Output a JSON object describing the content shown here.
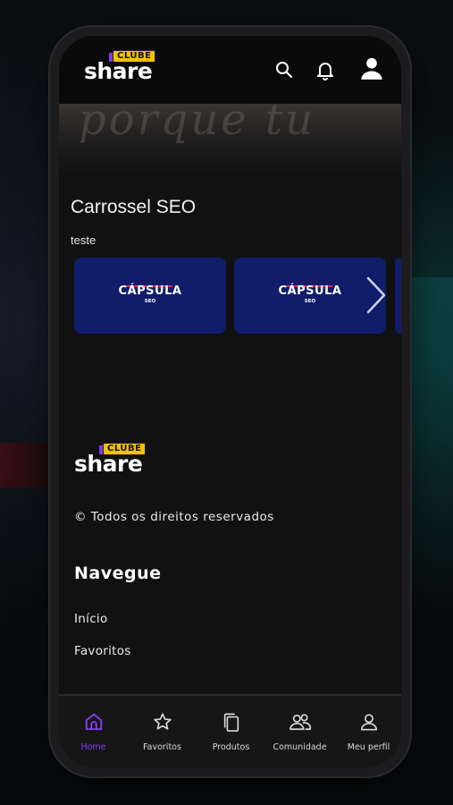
{
  "brand": {
    "badge": "CLUBE",
    "word": "share"
  },
  "header": {
    "icons": [
      "search-icon",
      "bell-icon",
      "user-icon"
    ]
  },
  "hero": {
    "text": "porque tu"
  },
  "section": {
    "title": "Carrossel SEO",
    "subtitle": "teste",
    "cards": [
      {
        "title": "CÁPSULA",
        "sub": "SEO"
      },
      {
        "title": "CÁPSULA",
        "sub": "SEO"
      }
    ]
  },
  "footer": {
    "rights": "© Todos os direitos reservados",
    "nav_title": "Navegue",
    "links": [
      "Início",
      "Favoritos"
    ]
  },
  "tabbar": {
    "tabs": [
      {
        "label": "Home",
        "icon": "home-icon",
        "active": true
      },
      {
        "label": "Favoritos",
        "icon": "star-icon",
        "active": false
      },
      {
        "label": "Produtos",
        "icon": "copy-icon",
        "active": false
      },
      {
        "label": "Comunidade",
        "icon": "users-icon",
        "active": false
      },
      {
        "label": "Meu perfil",
        "icon": "user-icon",
        "active": false
      }
    ]
  },
  "colors": {
    "accent": "#8b3df5",
    "card_bg": "#0f1d6b",
    "badge": "#f2c100"
  }
}
